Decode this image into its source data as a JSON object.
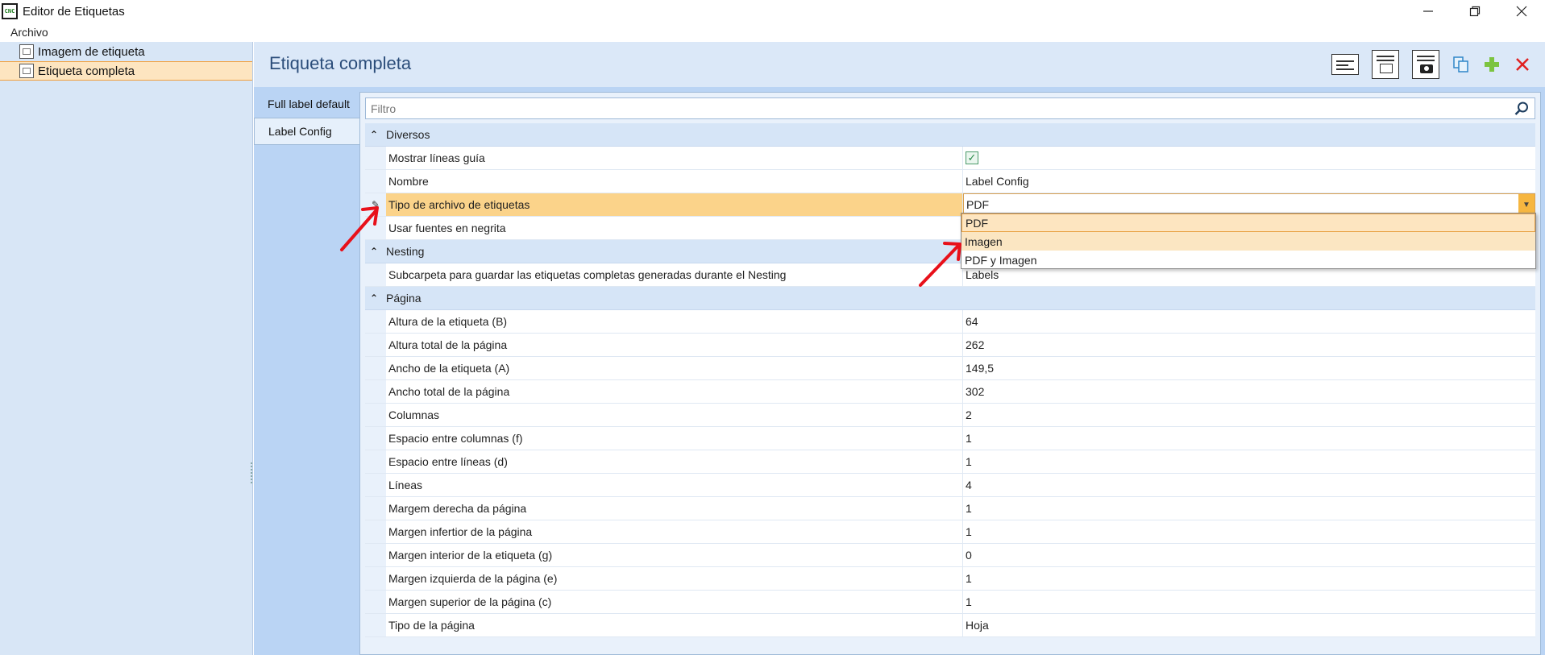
{
  "window": {
    "title": "Editor de Etiquetas",
    "app_icon_text": "CNC",
    "controls": [
      "minimize",
      "restore",
      "close"
    ]
  },
  "menu": {
    "items": [
      "Archivo"
    ]
  },
  "tree": {
    "items": [
      {
        "label": "Imagem de etiqueta",
        "icon": "label-image-icon",
        "selected": false
      },
      {
        "label": "Etiqueta completa",
        "icon": "full-label-icon",
        "selected": true
      }
    ]
  },
  "header": {
    "title": "Etiqueta completa",
    "toolbar": [
      "label-layout-icon",
      "page-layout-icon",
      "image-page-icon",
      "copy-icon",
      "add-icon",
      "delete-icon"
    ]
  },
  "tabs": [
    {
      "label": "Full label default",
      "active": false
    },
    {
      "label": "Label Config",
      "active": true
    }
  ],
  "filter": {
    "placeholder": "Filtro"
  },
  "grid": {
    "categories": [
      {
        "label": "Diversos",
        "rows": [
          {
            "name": "Mostrar líneas guía",
            "value": "",
            "type": "checkbox",
            "checked": true
          },
          {
            "name": "Nombre",
            "value": "Label Config"
          },
          {
            "name": "Tipo de archivo de etiquetas",
            "value": "PDF",
            "type": "dropdown",
            "editing": true
          },
          {
            "name": "Usar fuentes en negrita",
            "value": ""
          }
        ]
      },
      {
        "label": "Nesting",
        "rows": [
          {
            "name": "Subcarpeta para guardar las etiquetas completas generadas durante el Nesting",
            "value": "Labels"
          }
        ]
      },
      {
        "label": "Página",
        "rows": [
          {
            "name": "Altura de la etiqueta (B)",
            "value": "64"
          },
          {
            "name": "Altura total de la página",
            "value": "262"
          },
          {
            "name": "Ancho de la etiqueta (A)",
            "value": "149,5"
          },
          {
            "name": "Ancho total de la página",
            "value": "302"
          },
          {
            "name": "Columnas",
            "value": "2"
          },
          {
            "name": "Espacio entre columnas (f)",
            "value": "1"
          },
          {
            "name": "Espacio entre líneas (d)",
            "value": "1"
          },
          {
            "name": "Líneas",
            "value": "4"
          },
          {
            "name": "Margem derecha da página",
            "value": "1"
          },
          {
            "name": "Margen infertior de la página",
            "value": "1"
          },
          {
            "name": "Margen interior de la etiqueta (g)",
            "value": "0"
          },
          {
            "name": "Margen izquierda de la página (e)",
            "value": "1"
          },
          {
            "name": "Margen superior de la página (c)",
            "value": "1"
          },
          {
            "name": "Tipo de la página",
            "value": "Hoja"
          }
        ]
      }
    ]
  },
  "dropdown": {
    "options": [
      {
        "label": "PDF",
        "state": "selected"
      },
      {
        "label": "Imagen",
        "state": "hover"
      },
      {
        "label": "PDF y Imagen",
        "state": "normal"
      }
    ]
  },
  "colors": {
    "accent_selected": "#fde5c0",
    "highlight_row": "#fbd38a",
    "panel_bg": "#d8e6f6",
    "title_text": "#2b4d7a",
    "annotation_arrow": "#e8101a"
  }
}
